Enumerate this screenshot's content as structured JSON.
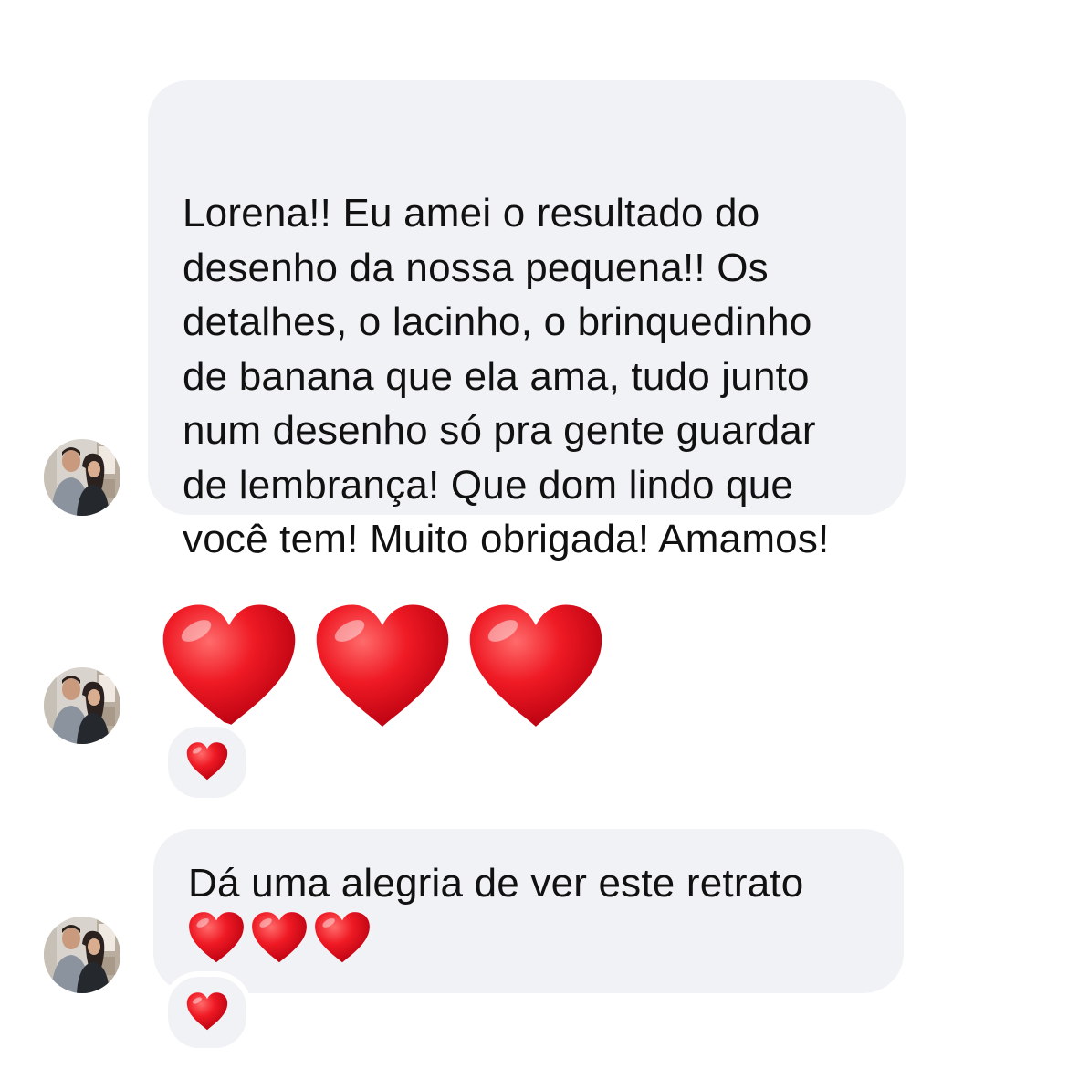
{
  "messages": [
    {
      "type": "text",
      "sender_avatar": "couple-avatar",
      "text": "Lorena!! Eu amei o resultado do\ndesenho da nossa pequena!! Os\ndetalhes, o lacinho, o brinquedinho\nde banana que ela ama, tudo junto\nnum desenho só pra gente guardar\nde lembrança! Que dom lindo que\nvocê tem! Muito obrigada! Amamos!"
    },
    {
      "type": "emoji",
      "sender_avatar": "couple-avatar",
      "emoji": [
        "red-heart",
        "red-heart",
        "red-heart"
      ],
      "reaction": "red-heart"
    },
    {
      "type": "text",
      "sender_avatar": "couple-avatar",
      "text": "Dá uma alegria de ver este retrato",
      "emoji": [
        "red-heart",
        "red-heart",
        "red-heart"
      ],
      "reaction": "red-heart"
    }
  ],
  "colors": {
    "bubble": "#f1f2f5",
    "heart": "#e8101c",
    "text": "#111111",
    "background": "#ffffff"
  }
}
